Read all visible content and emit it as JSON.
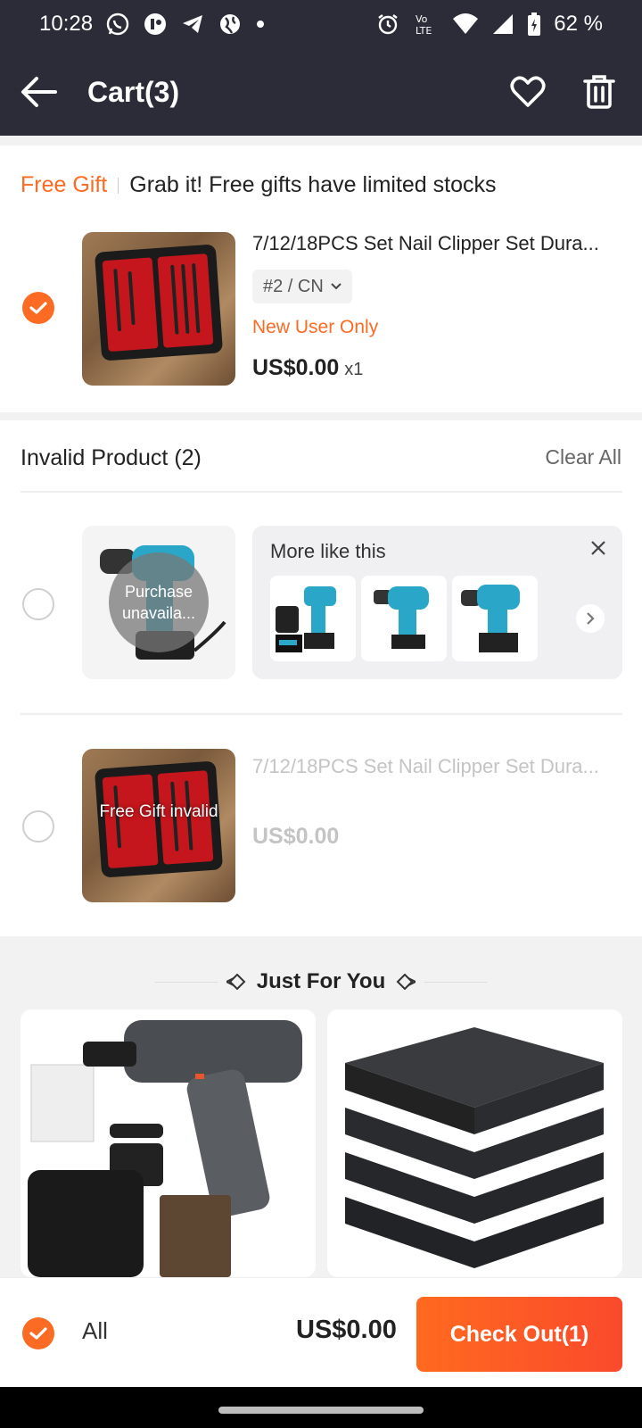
{
  "status_bar": {
    "time": "10:28",
    "battery": "62 %",
    "app_icons": [
      "whatsapp-icon",
      "app-icon",
      "telegram-icon",
      "globe-icon",
      "dot-icon"
    ],
    "system_icons": [
      "alarm-icon",
      "volte-icon",
      "wifi-icon",
      "signal-icon",
      "battery-icon"
    ]
  },
  "header": {
    "title": "Cart(3)"
  },
  "gift": {
    "tag": "Free Gift",
    "message": "Grab it! Free gifts have limited stocks",
    "item": {
      "name": "7/12/18PCS Set Nail Clipper Set Dura...",
      "variant": "#2 / CN",
      "badge": "New User Only",
      "price": "US$0.00",
      "qty": "x1",
      "checked": true
    }
  },
  "invalid": {
    "title": "Invalid Product (2)",
    "clear_all": "Clear All",
    "item1": {
      "overlay": "Purchase unavaila...",
      "more_like_this": "More like this"
    },
    "item2": {
      "overlay": "Free Gift invalid",
      "name": "7/12/18PCS Set Nail Clipper Set Dura...",
      "price": "US$0.00"
    }
  },
  "just_for_you": {
    "title": "Just For You"
  },
  "bottom": {
    "all_label": "All",
    "total": "US$0.00",
    "checkout": "Check Out(1)"
  },
  "colors": {
    "accent": "#fb6b24",
    "appbar": "#2b2c37",
    "checkout_gradient_end": "#fa4a2c"
  }
}
